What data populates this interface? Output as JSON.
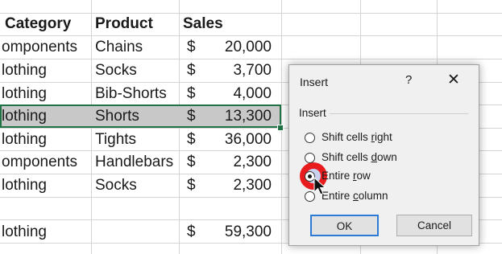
{
  "sheet": {
    "headers": [
      "Category",
      "Product",
      "Sales"
    ],
    "rows": [
      {
        "category": "omponents",
        "product": "Chains",
        "currency": "$",
        "sales": "20,000"
      },
      {
        "category": "lothing",
        "product": "Socks",
        "currency": "$",
        "sales": "3,700"
      },
      {
        "category": "lothing",
        "product": "Bib-Shorts",
        "currency": "$",
        "sales": "4,000"
      },
      {
        "category": "lothing",
        "product": "Shorts",
        "currency": "$",
        "sales": "13,300"
      },
      {
        "category": "lothing",
        "product": "Tights",
        "currency": "$",
        "sales": "36,000"
      },
      {
        "category": "omponents",
        "product": "Handlebars",
        "currency": "$",
        "sales": "2,300"
      },
      {
        "category": "lothing",
        "product": "Socks",
        "currency": "$",
        "sales": "2,300"
      }
    ],
    "summary": {
      "category": "lothing",
      "currency": "$",
      "sales": "59,300"
    }
  },
  "dialog": {
    "title": "Insert",
    "help": "?",
    "close": "✕",
    "group_label": "Insert",
    "options": [
      {
        "pre": "Shift cells ",
        "key": "r",
        "post": "ight"
      },
      {
        "pre": "Shift cells ",
        "key": "d",
        "post": "own"
      },
      {
        "pre": "Entire ",
        "key": "r",
        "post": "ow"
      },
      {
        "pre": "Entire ",
        "key": "c",
        "post": "olumn"
      }
    ],
    "ok_label": "OK",
    "cancel_label": "Cancel"
  },
  "colors": {
    "selection_border": "#217346",
    "highlight": "#e81c1c",
    "ok_border": "#2b7bd4"
  }
}
